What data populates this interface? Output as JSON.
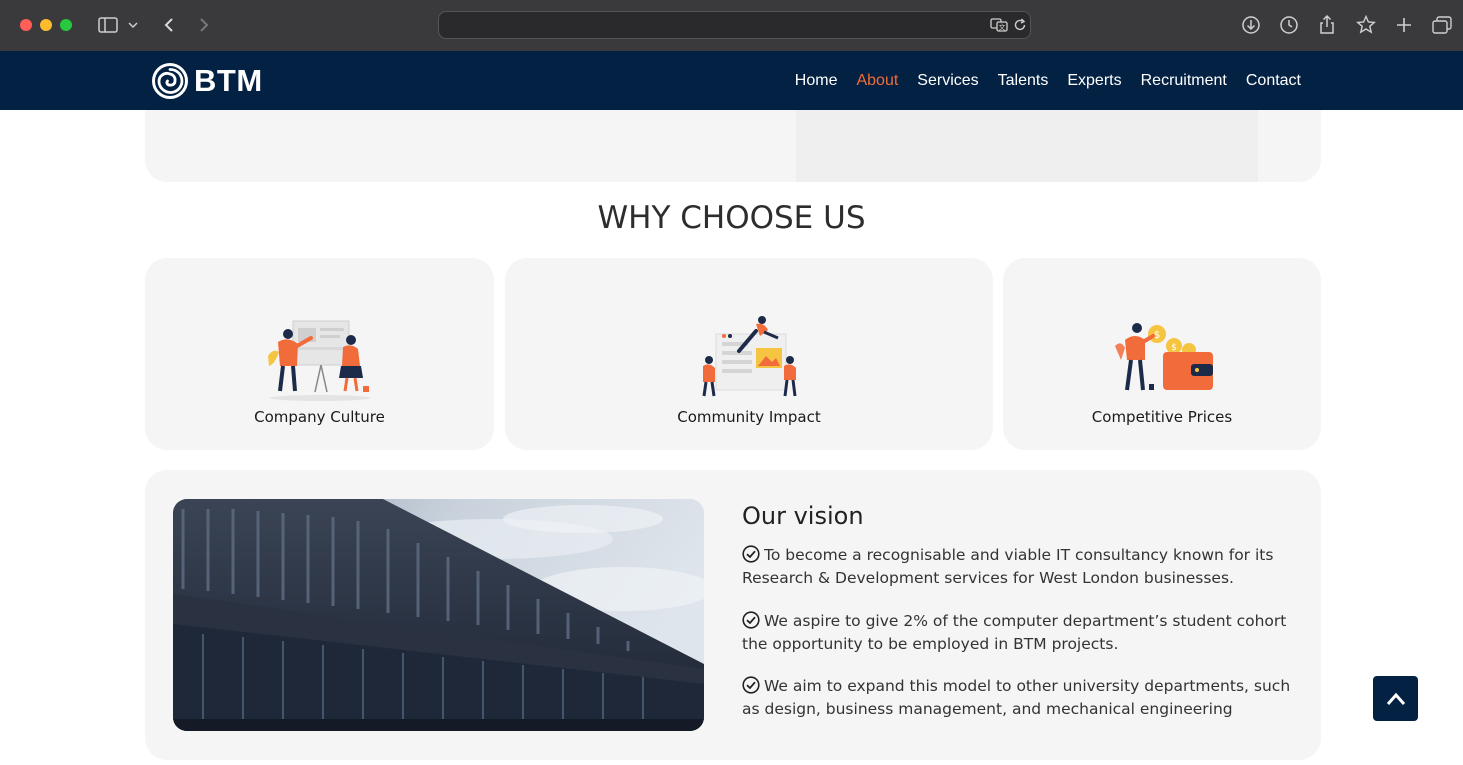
{
  "browser": {
    "url": "",
    "icons": [
      "sidebar-icon",
      "chevron-down-icon",
      "back-icon",
      "forward-icon",
      "translate-icon",
      "reload-icon",
      "download-icon",
      "history-icon",
      "share-icon",
      "bookmark-icon",
      "new-tab-icon",
      "tabs-icon"
    ]
  },
  "header": {
    "logo_text": "BTM",
    "nav": [
      {
        "label": "Home"
      },
      {
        "label": "About"
      },
      {
        "label": "Services"
      },
      {
        "label": "Talents"
      },
      {
        "label": "Experts"
      },
      {
        "label": "Recruitment"
      },
      {
        "label": "Contact"
      }
    ],
    "active_nav": "About"
  },
  "why": {
    "title": "WHY CHOOSE US",
    "features": [
      {
        "label": "Company Culture",
        "icon": "presentation-illustration"
      },
      {
        "label": "Community Impact",
        "icon": "teamwork-illustration"
      },
      {
        "label": "Competitive Prices",
        "icon": "wallet-coins-illustration"
      }
    ]
  },
  "vision": {
    "title": "Our vision",
    "items": [
      "To become a recognisable and viable IT consultancy known for its Research & Development services for West London businesses.",
      "We aspire to give 2% of the computer department’s student cohort the opportunity to be employed in BTM projects.",
      "We aim to expand this model to other university departments, such as design, business management, and mechanical engineering"
    ]
  },
  "colors": {
    "header_bg": "#032142",
    "accent": "#f26b3a",
    "card_bg": "#f5f5f5"
  }
}
